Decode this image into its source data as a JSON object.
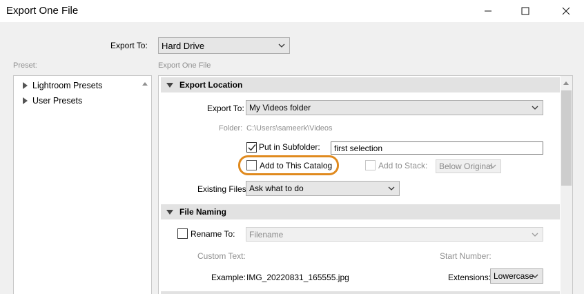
{
  "window": {
    "title": "Export One File"
  },
  "top": {
    "export_to_label": "Export To:",
    "export_to_value": "Hard Drive"
  },
  "preset": {
    "label": "Preset:",
    "items": [
      {
        "label": "Lightroom Presets"
      },
      {
        "label": "User Presets"
      }
    ]
  },
  "main": {
    "heading": "Export One File",
    "export_location": {
      "title": "Export Location",
      "export_to_label": "Export To:",
      "export_to_value": "My Videos folder",
      "folder_label": "Folder:",
      "folder_path": "C:\\Users\\sameerk\\Videos",
      "put_in_subfolder_label": "Put in Subfolder:",
      "put_in_subfolder_checked": true,
      "subfolder_value": "first selection",
      "add_to_catalog_label": "Add to This Catalog",
      "add_to_catalog_checked": false,
      "add_to_stack_label": "Add to Stack:",
      "stack_position_value": "Below Original",
      "existing_files_label": "Existing Files:",
      "existing_files_value": "Ask what to do"
    },
    "file_naming": {
      "title": "File Naming",
      "rename_to_label": "Rename To:",
      "rename_to_value": "Filename",
      "custom_text_label": "Custom Text:",
      "start_number_label": "Start Number:",
      "example_label": "Example:",
      "example_value": "IMG_20220831_165555.jpg",
      "extensions_label": "Extensions:",
      "extensions_value": "Lowercase"
    }
  },
  "colors": {
    "highlight_ring": "#e08a1e"
  }
}
